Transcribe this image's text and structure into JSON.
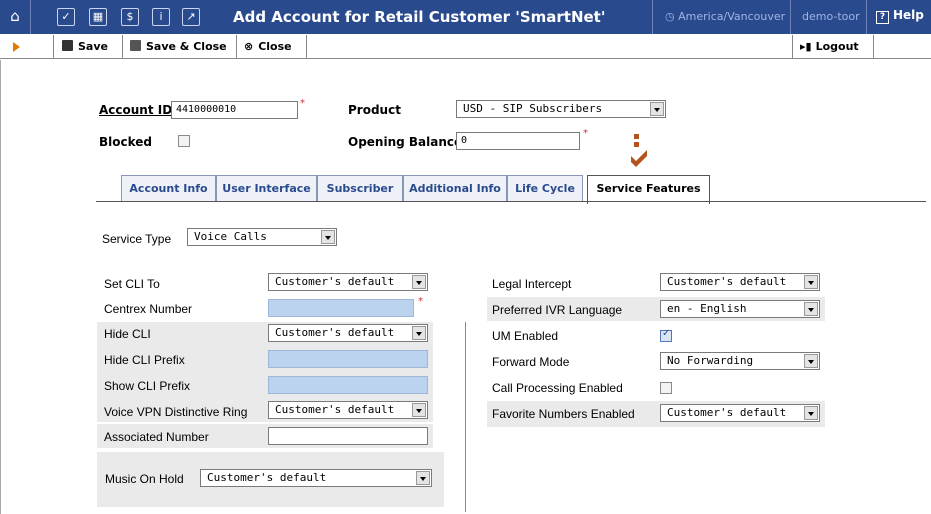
{
  "header": {
    "title": "Add Account for Retail Customer 'SmartNet'",
    "timezone": "America/Vancouver",
    "user": "demo-toor",
    "help": "Help"
  },
  "toolbar": {
    "save": "Save",
    "save_close": "Save & Close",
    "close": "Close",
    "logout": "Logout"
  },
  "account": {
    "id_label": "Account ID",
    "id_value": "4410000010",
    "blocked_label": "Blocked",
    "product_label": "Product",
    "product_value": "USD - SIP Subscribers",
    "balance_label": "Opening Balance",
    "balance_value": "0"
  },
  "tabs": [
    "Account Info",
    "User Interface",
    "Subscriber",
    "Additional Info",
    "Life Cycle",
    "Service Features"
  ],
  "service_type": {
    "label": "Service Type",
    "value": "Voice Calls"
  },
  "left_fields": {
    "set_cli_to": {
      "label": "Set CLI To",
      "value": "Customer's default"
    },
    "centrex_number": {
      "label": "Centrex Number",
      "value": ""
    },
    "hide_cli": {
      "label": "Hide CLI",
      "value": "Customer's default"
    },
    "hide_cli_prefix": {
      "label": "Hide CLI Prefix",
      "value": ""
    },
    "show_cli_prefix": {
      "label": "Show CLI Prefix",
      "value": ""
    },
    "vpn_ring": {
      "label": "Voice VPN Distinctive Ring",
      "value": "Customer's default"
    },
    "associated_number": {
      "label": "Associated Number",
      "value": ""
    },
    "music_on_hold": {
      "label": "Music On Hold",
      "value": "Customer's default"
    }
  },
  "right_fields": {
    "legal_intercept": {
      "label": "Legal Intercept",
      "value": "Customer's default"
    },
    "ivr_language": {
      "label": "Preferred IVR Language",
      "value": "en - English"
    },
    "um_enabled": {
      "label": "UM Enabled",
      "checked": true
    },
    "forward_mode": {
      "label": "Forward Mode",
      "value": "No Forwarding"
    },
    "call_processing": {
      "label": "Call Processing Enabled",
      "checked": false
    },
    "favorite_numbers": {
      "label": "Favorite Numbers Enabled",
      "value": "Customer's default"
    }
  },
  "colors": {
    "header_bg": "#2a4a8e",
    "tab_link": "#2a4a8e",
    "field_blue": "#bcd3f0",
    "marker": "#b5531e"
  }
}
